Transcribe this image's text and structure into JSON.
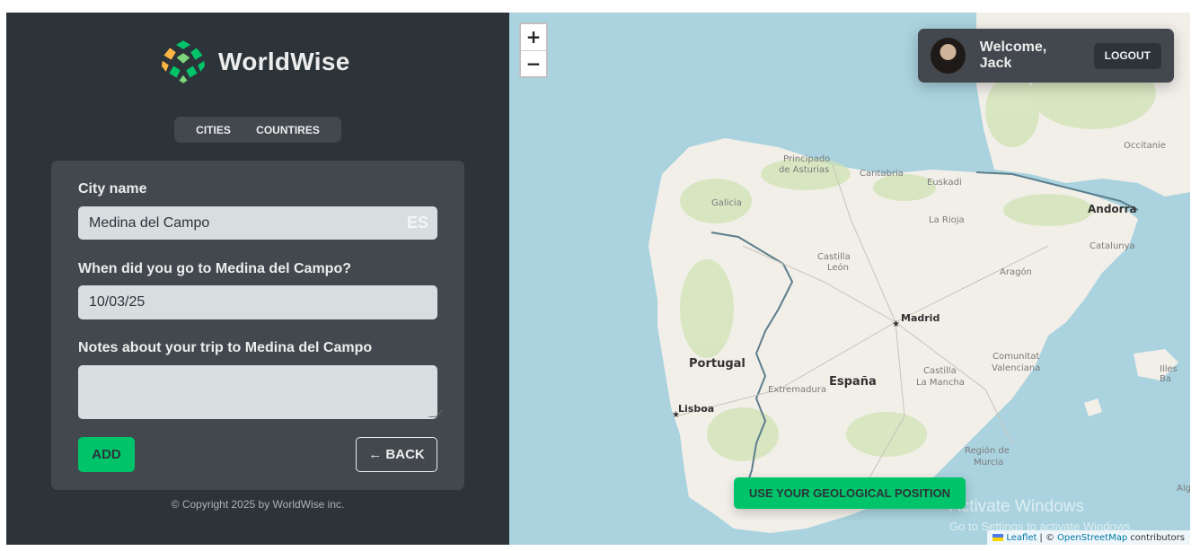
{
  "app": {
    "logo_text": "WorldWise"
  },
  "nav": {
    "cities": "CITIES",
    "countries": "COUNTIRES"
  },
  "form": {
    "city_label": "City name",
    "city_value": "Medina del Campo",
    "country_code": "ES",
    "date_label": "When did you go to Medina del Campo?",
    "date_value": "10/03/25",
    "notes_label": "Notes about your trip to Medina del Campo",
    "notes_value": "",
    "add_button": "ADD",
    "back_button": "← BACK"
  },
  "footer": {
    "copyright": "© Copyright 2025 by WorldWise inc."
  },
  "map": {
    "zoom_in": "+",
    "zoom_out": "−",
    "geo_button": "USE YOUR GEOLOGICAL POSITION",
    "places": {
      "portugal": "Portugal",
      "espana": "España",
      "madrid": "Madrid",
      "lisboa": "Lisboa",
      "andorra": "Andorra",
      "galicia": "Galicia",
      "asturias_1": "Principado",
      "asturias_2": "de Asturias",
      "cantabria": "Cantabria",
      "euskadi": "Euskadi",
      "la_rioja": "La Rioja",
      "castilla_leon_1": "Castilla",
      "castilla_leon_2": "León",
      "aragon": "Aragón",
      "catalunya": "Catalunya",
      "occitanie": "Occitanie",
      "extremadura": "Extremadura",
      "castilla_mancha_1": "Castilla",
      "castilla_mancha_2": "La Mancha",
      "comunitat_1": "Comunitat",
      "comunitat_2": "Valenciana",
      "murcia_1": "Región de",
      "murcia_2": "Murcia",
      "illes": "Illes Ba",
      "alg": "Alg"
    },
    "attribution": {
      "leaflet": "Leaflet",
      "separator": "| ©",
      "osm": "OpenStreetMap",
      "contributors": "contributors"
    },
    "watermark": {
      "title": "Activate Windows",
      "subtitle": "Go to Settings to activate Windows."
    }
  },
  "user": {
    "welcome": "Welcome, Jack",
    "logout": "LOGOUT"
  },
  "colors": {
    "sidebar_bg": "#2d3439",
    "panel_bg": "#42484d",
    "brand_green": "#00c46a",
    "sea": "#aad3df",
    "land": "#f2efe9"
  }
}
